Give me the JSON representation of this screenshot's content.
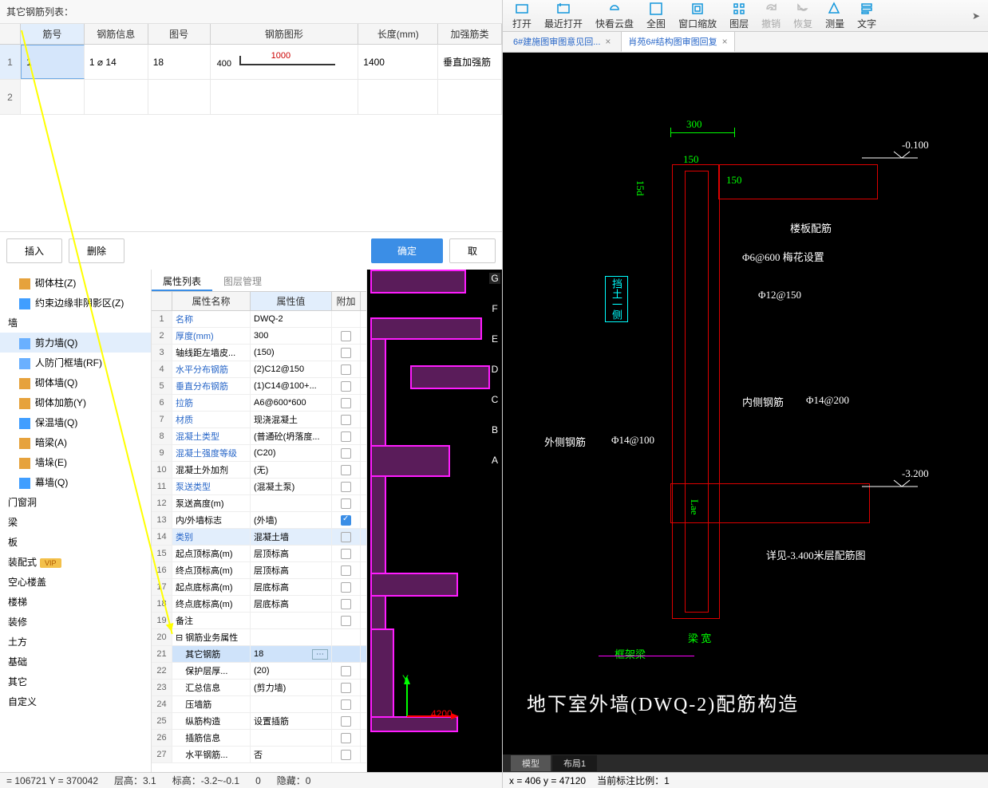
{
  "rebar_list": {
    "title": "其它钢筋列表：",
    "headers": {
      "jh": "筋号",
      "info": "钢筋信息",
      "tu": "图号",
      "shape": "钢筋图形",
      "len": "长度(mm)",
      "jq": "加强筋类"
    },
    "rows": [
      {
        "n": "1",
        "jh": "1",
        "info": "1 ⌀ 14",
        "tu": "18",
        "s400": "400",
        "s1000": "1000",
        "len": "1400",
        "jq": "垂直加强筋"
      },
      {
        "n": "2",
        "jh": "",
        "info": "",
        "tu": "",
        "s400": "",
        "s1000": "",
        "len": "",
        "jq": ""
      }
    ],
    "btn_insert": "插入",
    "btn_delete": "删除",
    "btn_ok": "确定",
    "btn_cancel": "取"
  },
  "tree": {
    "items": [
      {
        "t": "砌体柱(Z)",
        "ic": "#e6a23c",
        "l": 2
      },
      {
        "t": "约束边缘非阴影区(Z)",
        "ic": "#409eff",
        "l": 2
      },
      {
        "t": "墙",
        "ic": "",
        "l": 1
      },
      {
        "t": "剪力墙(Q)",
        "ic": "#6ab0ff",
        "l": 2,
        "sel": true
      },
      {
        "t": "人防门框墙(RF)",
        "ic": "#6ab0ff",
        "l": 2
      },
      {
        "t": "砌体墙(Q)",
        "ic": "#e6a23c",
        "l": 2
      },
      {
        "t": "砌体加筋(Y)",
        "ic": "#e6a23c",
        "l": 2
      },
      {
        "t": "保温墙(Q)",
        "ic": "#409eff",
        "l": 2
      },
      {
        "t": "暗梁(A)",
        "ic": "#e6a23c",
        "l": 2
      },
      {
        "t": "墙垛(E)",
        "ic": "#e6a23c",
        "l": 2
      },
      {
        "t": "幕墙(Q)",
        "ic": "#409eff",
        "l": 2
      },
      {
        "t": "门窗洞",
        "ic": "",
        "l": 1
      },
      {
        "t": "梁",
        "ic": "",
        "l": 1
      },
      {
        "t": "板",
        "ic": "",
        "l": 1
      },
      {
        "t": "装配式",
        "ic": "",
        "l": 1,
        "vip": true
      },
      {
        "t": "空心楼盖",
        "ic": "",
        "l": 1
      },
      {
        "t": "楼梯",
        "ic": "",
        "l": 1
      },
      {
        "t": "装修",
        "ic": "",
        "l": 1
      },
      {
        "t": "土方",
        "ic": "",
        "l": 1
      },
      {
        "t": "基础",
        "ic": "",
        "l": 1
      },
      {
        "t": "其它",
        "ic": "",
        "l": 1
      },
      {
        "t": "自定义",
        "ic": "",
        "l": 1
      }
    ]
  },
  "props": {
    "tab1": "属性列表",
    "tab2": "图层管理",
    "h_name": "属性名称",
    "h_val": "属性值",
    "h_add": "附加",
    "rows": [
      {
        "n": "1",
        "name": "名称",
        "val": "DWQ-2",
        "link": true
      },
      {
        "n": "2",
        "name": "厚度(mm)",
        "val": "300",
        "link": true,
        "chk": false
      },
      {
        "n": "3",
        "name": "轴线距左墙皮...",
        "val": "(150)",
        "chk": false
      },
      {
        "n": "4",
        "name": "水平分布钢筋",
        "val": "(2)C12@150",
        "link": true,
        "chk": false
      },
      {
        "n": "5",
        "name": "垂直分布钢筋",
        "val": "(1)C14@100+...",
        "link": true,
        "chk": false
      },
      {
        "n": "6",
        "name": "拉筋",
        "val": "A6@600*600",
        "link": true,
        "chk": false
      },
      {
        "n": "7",
        "name": "材质",
        "val": "现浇混凝土",
        "link": true,
        "chk": false
      },
      {
        "n": "8",
        "name": "混凝土类型",
        "val": "(普通砼(坍落度...",
        "link": true,
        "chk": false
      },
      {
        "n": "9",
        "name": "混凝土强度等级",
        "val": "(C20)",
        "link": true,
        "chk": false
      },
      {
        "n": "10",
        "name": "混凝土外加剂",
        "val": "(无)",
        "chk": false
      },
      {
        "n": "11",
        "name": "泵送类型",
        "val": "(混凝土泵)",
        "link": true,
        "chk": false
      },
      {
        "n": "12",
        "name": "泵送高度(m)",
        "val": "",
        "chk": false
      },
      {
        "n": "13",
        "name": "内/外墙标志",
        "val": "(外墙)",
        "chk": true
      },
      {
        "n": "14",
        "name": "类别",
        "val": "混凝土墙",
        "link": true,
        "chk": false,
        "hl": true
      },
      {
        "n": "15",
        "name": "起点顶标高(m)",
        "val": "层顶标高",
        "chk": false
      },
      {
        "n": "16",
        "name": "终点顶标高(m)",
        "val": "层顶标高",
        "chk": false
      },
      {
        "n": "17",
        "name": "起点底标高(m)",
        "val": "层底标高",
        "chk": false
      },
      {
        "n": "18",
        "name": "终点底标高(m)",
        "val": "层底标高",
        "chk": false
      },
      {
        "n": "19",
        "name": "备注",
        "val": "",
        "chk": false
      },
      {
        "n": "20",
        "name": "⊟ 钢筋业务属性",
        "val": "",
        "grp": true
      },
      {
        "n": "21",
        "name": "其它钢筋",
        "val": "18",
        "hl2": true,
        "dots": true,
        "ind": true
      },
      {
        "n": "22",
        "name": "保护层厚...",
        "val": "(20)",
        "chk": false,
        "ind": true
      },
      {
        "n": "23",
        "name": "汇总信息",
        "val": "(剪力墙)",
        "chk": false,
        "ind": true
      },
      {
        "n": "24",
        "name": "压墙筋",
        "val": "",
        "chk": false,
        "ind": true
      },
      {
        "n": "25",
        "name": "纵筋构造",
        "val": "设置插筋",
        "chk": false,
        "ind": true
      },
      {
        "n": "26",
        "name": "插筋信息",
        "val": "",
        "chk": false,
        "ind": true
      },
      {
        "n": "27",
        "name": "水平钢筋...",
        "val": "否",
        "chk": false,
        "ind": true
      }
    ]
  },
  "status1": {
    "xy": "= 106721 Y = 370042",
    "ch": "层高：3.1",
    "bg": "标高：-3.2~-0.1",
    "zero": "0",
    "yc": "隐藏：0"
  },
  "toolbar": [
    {
      "t": "打开",
      "c": "#1296db"
    },
    {
      "t": "最近打开",
      "c": "#1296db"
    },
    {
      "t": "快看云盘",
      "c": "#1296db"
    },
    {
      "t": "全图",
      "c": "#1296db"
    },
    {
      "t": "窗口缩放",
      "c": "#1296db"
    },
    {
      "t": "图层",
      "c": "#1296db"
    },
    {
      "t": "撤销",
      "c": "#999",
      "dis": true
    },
    {
      "t": "恢复",
      "c": "#999",
      "dis": true
    },
    {
      "t": "测量",
      "c": "#1296db"
    },
    {
      "t": "文字",
      "c": "#1296db"
    }
  ],
  "tabs2": [
    {
      "t": "6#建施图审图意见回...",
      "act": false
    },
    {
      "t": "肖苑6#结构图审图回复",
      "act": true
    }
  ],
  "cad": {
    "d300": "300",
    "d150a": "150",
    "d150b": "150",
    "d15d": "15d",
    "dangtu": "挡土一侧",
    "lbpj": "楼板配筋",
    "mh": "Φ6@600 梅花设置",
    "p12": "Φ12@150",
    "nc": "内侧钢筋",
    "p14b": "Φ14@200",
    "wc": "外侧钢筋",
    "p14a": "Φ14@100",
    "lae": "Lae",
    "xj": "详见-3.400米层配筋图",
    "lk": "梁 宽",
    "kjl": "框架梁",
    "title": "地下室外墙(DWQ-2)配筋构造",
    "lv1": "-0.100",
    "lv2": "-3.200",
    "ax_x": "4200",
    "ax_y": "Y",
    "model": "模型",
    "layout": "布局1"
  },
  "status2": {
    "xy": "x = 406 y = 47120",
    "scale": "当前标注比例：1"
  }
}
